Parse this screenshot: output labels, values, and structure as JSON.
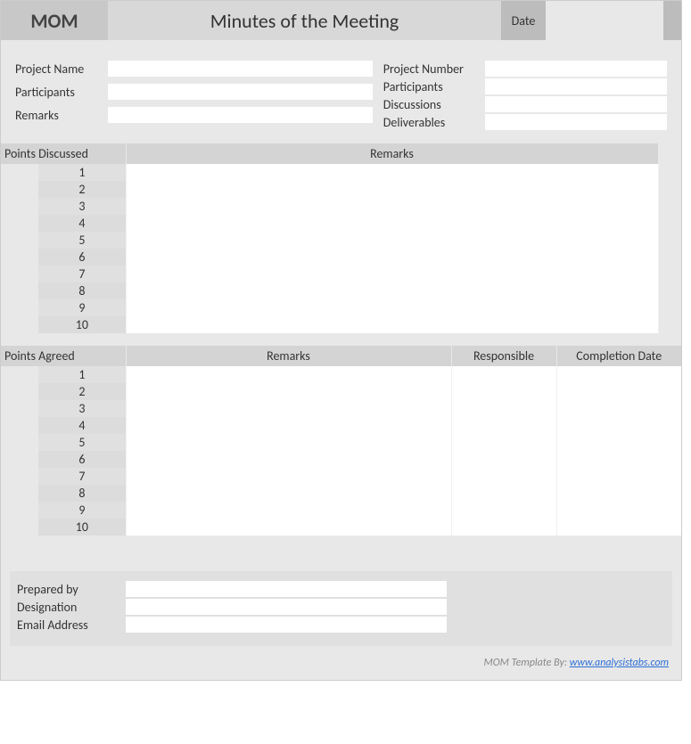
{
  "header": {
    "short": "MOM",
    "title": "Minutes of the Meeting",
    "date_label": "Date",
    "date_value": ""
  },
  "info_left": {
    "project_name_label": "Project Name",
    "project_name_value": "",
    "participants_label": "Participants",
    "participants_value": "",
    "remarks_label": "Remarks",
    "remarks_value": ""
  },
  "info_right": {
    "project_number_label": "Project Number",
    "project_number_value": "",
    "participants_label": "Participants",
    "participants_value": "",
    "discussions_label": "Discussions",
    "discussions_value": "",
    "deliverables_label": "Deliverables",
    "deliverables_value": ""
  },
  "discussed": {
    "col_points": "Points Discussed",
    "col_remarks": "Remarks",
    "rows": [
      "1",
      "2",
      "3",
      "4",
      "5",
      "6",
      "7",
      "8",
      "9",
      "10"
    ]
  },
  "agreed": {
    "col_points": "Points Agreed",
    "col_remarks": "Remarks",
    "col_responsible": "Responsible",
    "col_completion": "Completion Date",
    "rows": [
      "1",
      "2",
      "3",
      "4",
      "5",
      "6",
      "7",
      "8",
      "9",
      "10"
    ]
  },
  "footer": {
    "prepared_by_label": "Prepared by",
    "prepared_by_value": "",
    "designation_label": "Designation",
    "designation_value": "",
    "email_label": "Email Address",
    "email_value": ""
  },
  "credit": {
    "prefix": "MOM Template By: ",
    "link_text": "www.analysistabs.com"
  }
}
